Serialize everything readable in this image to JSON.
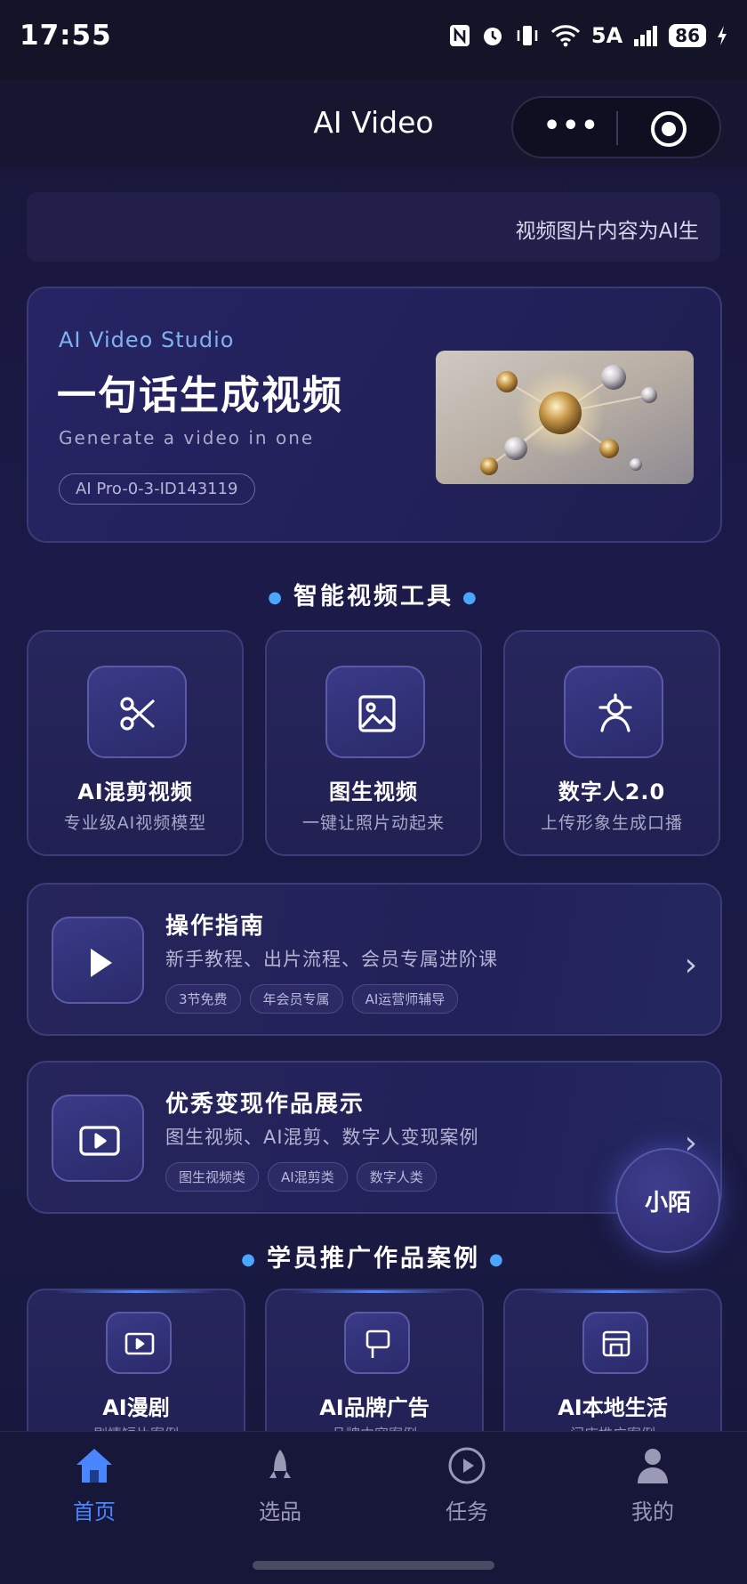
{
  "status_bar": {
    "time": "17:55",
    "icons": [
      "nfc-icon",
      "alarm-icon",
      "vibrate-icon",
      "wifi-icon",
      "signal-icon"
    ],
    "network": "5A",
    "battery": "86"
  },
  "nav": {
    "title": "AI Video",
    "more_label": "•••"
  },
  "notice": {
    "text": "视频图片内容为AI生"
  },
  "hero": {
    "kicker": "AI Video Studio",
    "title": "一句话生成视频",
    "subtitle": "Generate a video in one",
    "model_tag": "AI Pro-0-3-ID143119"
  },
  "tools_section": {
    "title": "智能视频工具",
    "items": [
      {
        "name": "AI混剪视频",
        "desc": "专业级AI视频模型",
        "icon": "scissors-icon"
      },
      {
        "name": "图生视频",
        "desc": "一键让照片动起来",
        "icon": "image-icon"
      },
      {
        "name": "数字人2.0",
        "desc": "上传形象生成口播",
        "icon": "digital-human-icon"
      }
    ]
  },
  "features": [
    {
      "title": "操作指南",
      "subtitle": "新手教程、出片流程、会员专属进阶课",
      "tags": [
        "3节免费",
        "年会员专属",
        "AI运营师辅导"
      ],
      "icon": "play-icon"
    },
    {
      "title": "优秀变现作品展示",
      "subtitle": "图生视频、AI混剪、数字人变现案例",
      "tags": [
        "图生视频类",
        "AI混剪类",
        "数字人类"
      ],
      "icon": "video-play-icon"
    }
  ],
  "float_button": {
    "label": "小陌"
  },
  "cases_section": {
    "title": "学员推广作品案例",
    "items": [
      {
        "name": "AI漫剧",
        "desc": "剧情短片案例",
        "icon": "screen-icon"
      },
      {
        "name": "AI品牌广告",
        "desc": "品牌内容案例",
        "icon": "billboard-icon"
      },
      {
        "name": "AI本地生活",
        "desc": "门店推广案例",
        "icon": "store-icon"
      }
    ]
  },
  "tab_bar": {
    "items": [
      {
        "label": "首页",
        "icon": "home-icon",
        "active": true
      },
      {
        "label": "选品",
        "icon": "rocket-icon",
        "active": false
      },
      {
        "label": "任务",
        "icon": "play-circle-icon",
        "active": false
      },
      {
        "label": "我的",
        "icon": "profile-icon",
        "active": false
      }
    ]
  },
  "colors": {
    "accent": "#4a86ff",
    "background": "#1b1a48",
    "card": "#26255b",
    "card_border": "#3d3c78",
    "kicker": "#7fb2ef"
  }
}
